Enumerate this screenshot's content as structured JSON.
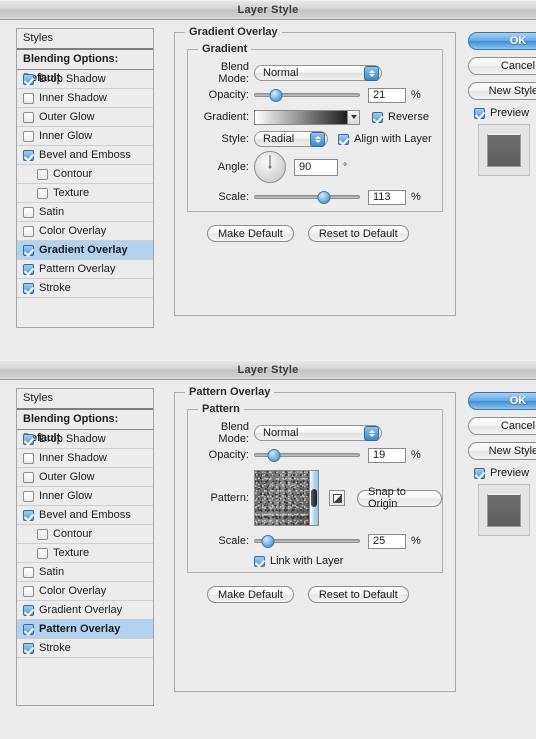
{
  "window": {
    "title": "Layer Style"
  },
  "sidebar": {
    "header": "Styles",
    "blending_options": "Blending Options: Default",
    "items": [
      {
        "label": "Drop Shadow",
        "checked": true,
        "indent": false
      },
      {
        "label": "Inner Shadow",
        "checked": false,
        "indent": false
      },
      {
        "label": "Outer Glow",
        "checked": false,
        "indent": false
      },
      {
        "label": "Inner Glow",
        "checked": false,
        "indent": false
      },
      {
        "label": "Bevel and Emboss",
        "checked": true,
        "indent": false
      },
      {
        "label": "Contour",
        "checked": false,
        "indent": true
      },
      {
        "label": "Texture",
        "checked": false,
        "indent": true
      },
      {
        "label": "Satin",
        "checked": false,
        "indent": false
      },
      {
        "label": "Color Overlay",
        "checked": false,
        "indent": false
      },
      {
        "label": "Gradient Overlay",
        "checked": true,
        "indent": false
      },
      {
        "label": "Pattern Overlay",
        "checked": true,
        "indent": false
      },
      {
        "label": "Stroke",
        "checked": true,
        "indent": false
      }
    ]
  },
  "gradient_panel": {
    "outer_legend": "Gradient Overlay",
    "inner_legend": "Gradient",
    "blend_mode_label": "Blend Mode:",
    "blend_mode_value": "Normal",
    "opacity_label": "Opacity:",
    "opacity_value": "21",
    "opacity_unit": "%",
    "opacity_percent": 21,
    "gradient_label": "Gradient:",
    "gradient_from": "#ffffff",
    "gradient_to": "#000000",
    "reverse_label": "Reverse",
    "reverse_checked": true,
    "style_label": "Style:",
    "style_value": "Radial",
    "align_label": "Align with Layer",
    "align_checked": true,
    "angle_label": "Angle:",
    "angle_value": "90",
    "angle_unit": "°",
    "scale_label": "Scale:",
    "scale_value": "113",
    "scale_unit": "%",
    "scale_percent": 66,
    "make_default": "Make Default",
    "reset_default": "Reset to Default"
  },
  "pattern_panel": {
    "outer_legend": "Pattern Overlay",
    "inner_legend": "Pattern",
    "blend_mode_label": "Blend Mode:",
    "blend_mode_value": "Normal",
    "opacity_label": "Opacity:",
    "opacity_value": "19",
    "opacity_unit": "%",
    "opacity_percent": 19,
    "pattern_label": "Pattern:",
    "snap_to_origin": "Snap to Origin",
    "scale_label": "Scale:",
    "scale_value": "25",
    "scale_unit": "%",
    "scale_percent": 13,
    "link_label": "Link with Layer",
    "link_checked": true,
    "make_default": "Make Default",
    "reset_default": "Reset to Default"
  },
  "buttons": {
    "ok": "OK",
    "cancel": "Cancel",
    "new_style": "New Style...",
    "preview": "Preview",
    "preview_checked": true
  },
  "colors": {
    "accent_blue": "#4f96d8",
    "selection_blue": "#b2d3f0",
    "dialog_bg": "#ececec"
  }
}
